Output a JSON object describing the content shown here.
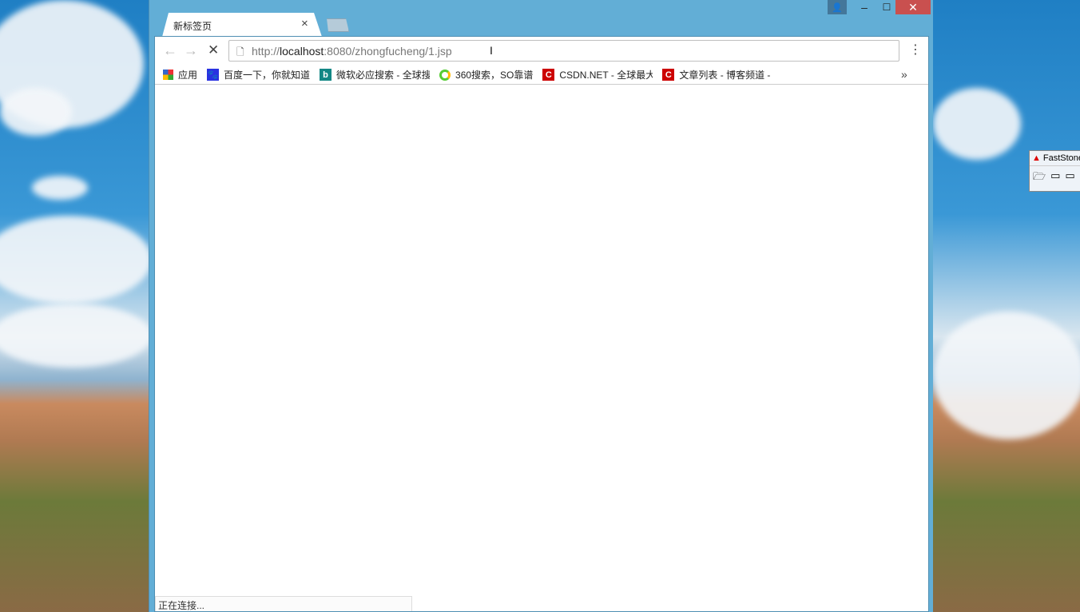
{
  "browser": {
    "tab": {
      "title": "新标签页",
      "close": "×"
    },
    "url": {
      "scheme": "http://",
      "host": "localhost",
      "rest": ":8080/zhongfucheng/1.jsp"
    },
    "bookmarks": [
      {
        "label": "应用",
        "icon": "apps-grid-icon"
      },
      {
        "label": "百度一下，你就知道",
        "icon": "baidu-paw-icon"
      },
      {
        "label": "微软必应搜索 - 全球搜",
        "icon": "bing-icon"
      },
      {
        "label": "360搜索，SO靠谱",
        "icon": "360-search-icon"
      },
      {
        "label": "CSDN.NET - 全球最大",
        "icon": "csdn-icon"
      },
      {
        "label": "文章列表 - 博客频道 -",
        "icon": "csdn-icon"
      }
    ],
    "overflow": "»",
    "status": "正在连接..."
  },
  "faststone": {
    "title": "FastStone"
  }
}
